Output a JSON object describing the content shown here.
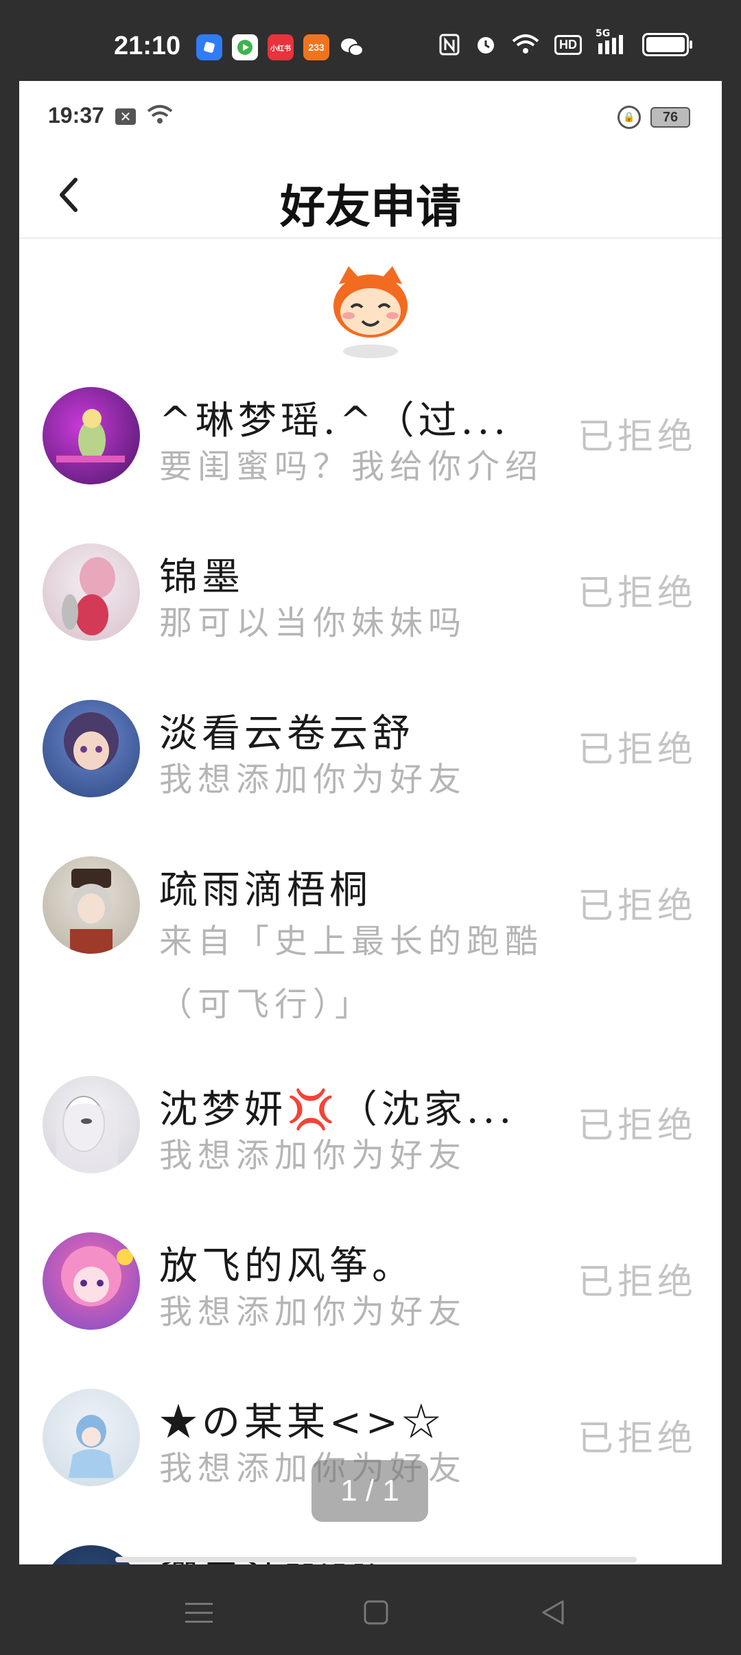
{
  "outer_status": {
    "time": "21:10",
    "app_icons": [
      {
        "name": "blue-app-icon",
        "color": "#2f7cf6",
        "label": ""
      },
      {
        "name": "video-app-icon",
        "color": "#3fb24f",
        "label": ""
      },
      {
        "name": "xiaomi-app-icon",
        "color": "#e8323c",
        "label": "小红书"
      },
      {
        "name": "233-app-icon",
        "color": "#f0741e",
        "label": "233"
      },
      {
        "name": "wechat-icon",
        "color": "#ffffff",
        "label": ""
      }
    ],
    "hd_label": "HD",
    "signal_label": "5G"
  },
  "inner_status": {
    "time": "19:37",
    "battery": "76"
  },
  "header": {
    "title": "好友申请"
  },
  "requests": [
    {
      "name": "^琳梦瑶.^（过...",
      "message": "要闺蜜吗？我给你介绍",
      "status": "已拒绝",
      "avatar_colors": [
        "#4a1768",
        "#c83ad8"
      ]
    },
    {
      "name": "锦墨",
      "message": "那可以当你妹妹吗",
      "status": "已拒绝",
      "avatar_colors": [
        "#e7dfe6",
        "#d8a3b0"
      ]
    },
    {
      "name": "淡看云卷云舒",
      "message": "我想添加你为好友",
      "status": "已拒绝",
      "avatar_colors": [
        "#3d5a9e",
        "#6a4c8e"
      ]
    },
    {
      "name": "疏雨滴梧桐",
      "message": "来自「史上最长的跑酷（可飞行）」",
      "status": "已拒绝",
      "avatar_colors": [
        "#d7d2c8",
        "#8a5a3a"
      ]
    },
    {
      "name": "沈梦妍💢（沈家...",
      "message": "我想添加你为好友",
      "status": "已拒绝",
      "avatar_colors": [
        "#e9e9ec",
        "#b8b6bd"
      ]
    },
    {
      "name": "放飞的风筝。",
      "message": "我想添加你为好友",
      "status": "已拒绝",
      "avatar_colors": [
        "#e0549a",
        "#7f4cc8"
      ]
    },
    {
      "name": "★の某某<>☆",
      "message": "我想添加你为好友",
      "status": "已拒绝",
      "avatar_colors": [
        "#dfe8ef",
        "#88b6e2"
      ]
    },
    {
      "name": "卿子沫XiVi",
      "message": "",
      "status": "",
      "avatar_colors": [
        "#2a4a7a",
        "#1c2c4a"
      ]
    }
  ],
  "page_indicator": "1 / 1"
}
